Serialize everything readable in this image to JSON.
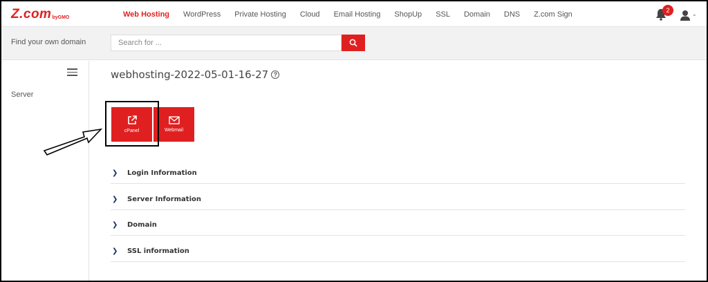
{
  "brand": {
    "name": "Z.com",
    "sub": "byGMO",
    "accent": "#e02020"
  },
  "nav": {
    "items": [
      "Web Hosting",
      "WordPress",
      "Private Hosting",
      "Cloud",
      "Email Hosting",
      "ShopUp",
      "SSL",
      "Domain",
      "DNS",
      "Z.com Sign"
    ],
    "active": "Web Hosting"
  },
  "notifications": {
    "count": "2",
    "icon": "bell-icon"
  },
  "account": {
    "icon": "user-icon"
  },
  "search": {
    "label": "Find your own domain",
    "placeholder": "Search for ...",
    "button_icon": "search-icon"
  },
  "sidebar": {
    "items": [
      {
        "label": "Server"
      }
    ]
  },
  "main": {
    "title": "webhosting-2022-05-01-16-27",
    "help_icon": "?",
    "tiles": [
      {
        "label": "cPanel",
        "icon": "external-link-icon"
      },
      {
        "label": "Webmail",
        "icon": "envelope-icon"
      }
    ],
    "sections": [
      {
        "label": "Login Information"
      },
      {
        "label": "Server Information"
      },
      {
        "label": "Domain"
      },
      {
        "label": "SSL information"
      }
    ]
  }
}
